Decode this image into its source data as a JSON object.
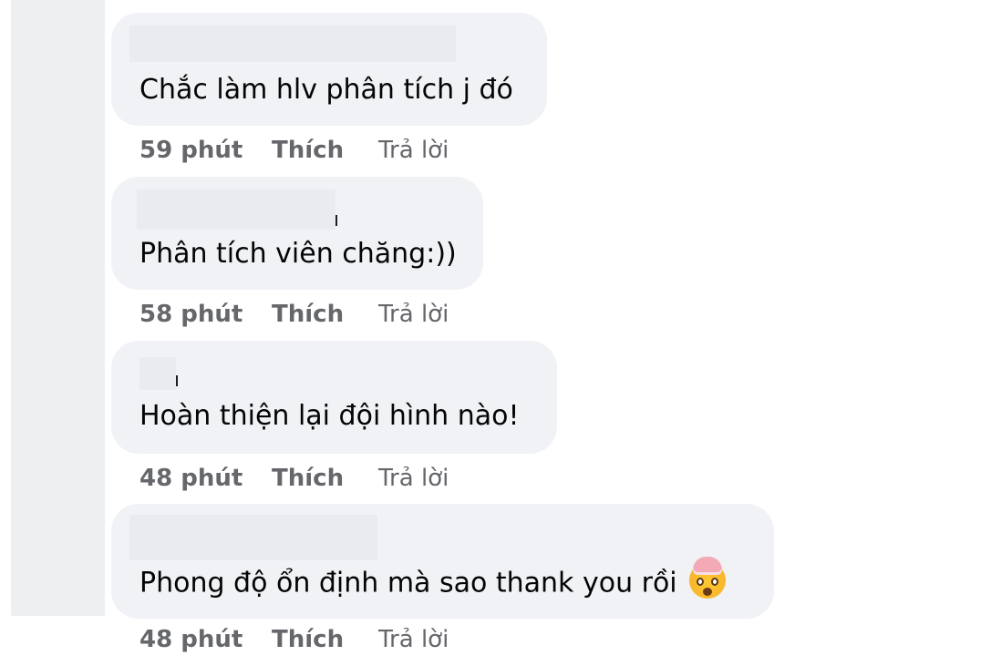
{
  "comments": [
    {
      "text": "Chắc làm hlv phân tích j đó",
      "time": "59 phút",
      "like": "Thích",
      "reply": "Trả lời"
    },
    {
      "text": "Phân tích viên chăng:))",
      "time": "58 phút",
      "like": "Thích",
      "reply": "Trả lời"
    },
    {
      "text": "Hoàn thiện lại đội hình nào!",
      "time": "48 phút",
      "like": "Thích",
      "reply": "Trả lời"
    },
    {
      "text": "Phong độ ổn định mà sao thank you rồi",
      "emoji": "exploding-head-emoji",
      "time": "48 phút",
      "like": "Thích",
      "reply": "Trả lời"
    }
  ],
  "colors": {
    "bubble": "#f0f2f5",
    "text": "#050505",
    "meta": "#65676b"
  }
}
